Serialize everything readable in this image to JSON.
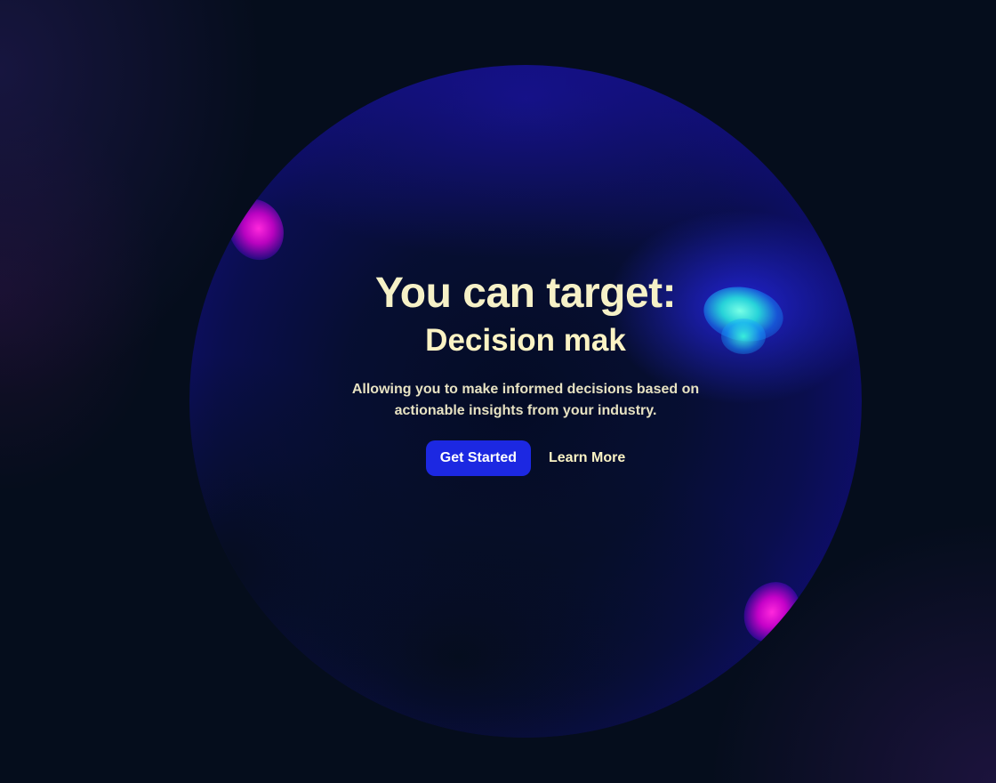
{
  "hero": {
    "headline": "You can target:",
    "rotating_text": "Decision mak",
    "description": "Allowing you to make informed decisions based on actionable insights from your industry.",
    "primary_cta": "Get Started",
    "secondary_cta": "Learn More"
  },
  "colors": {
    "background": "#050d1c",
    "headline": "#f6f1c7",
    "primary_button": "#1c28e2",
    "orb_rim": "#3200ff",
    "orb_highlight_cyan": "#3ce6dc",
    "orb_highlight_pink": "#ff28dc"
  }
}
